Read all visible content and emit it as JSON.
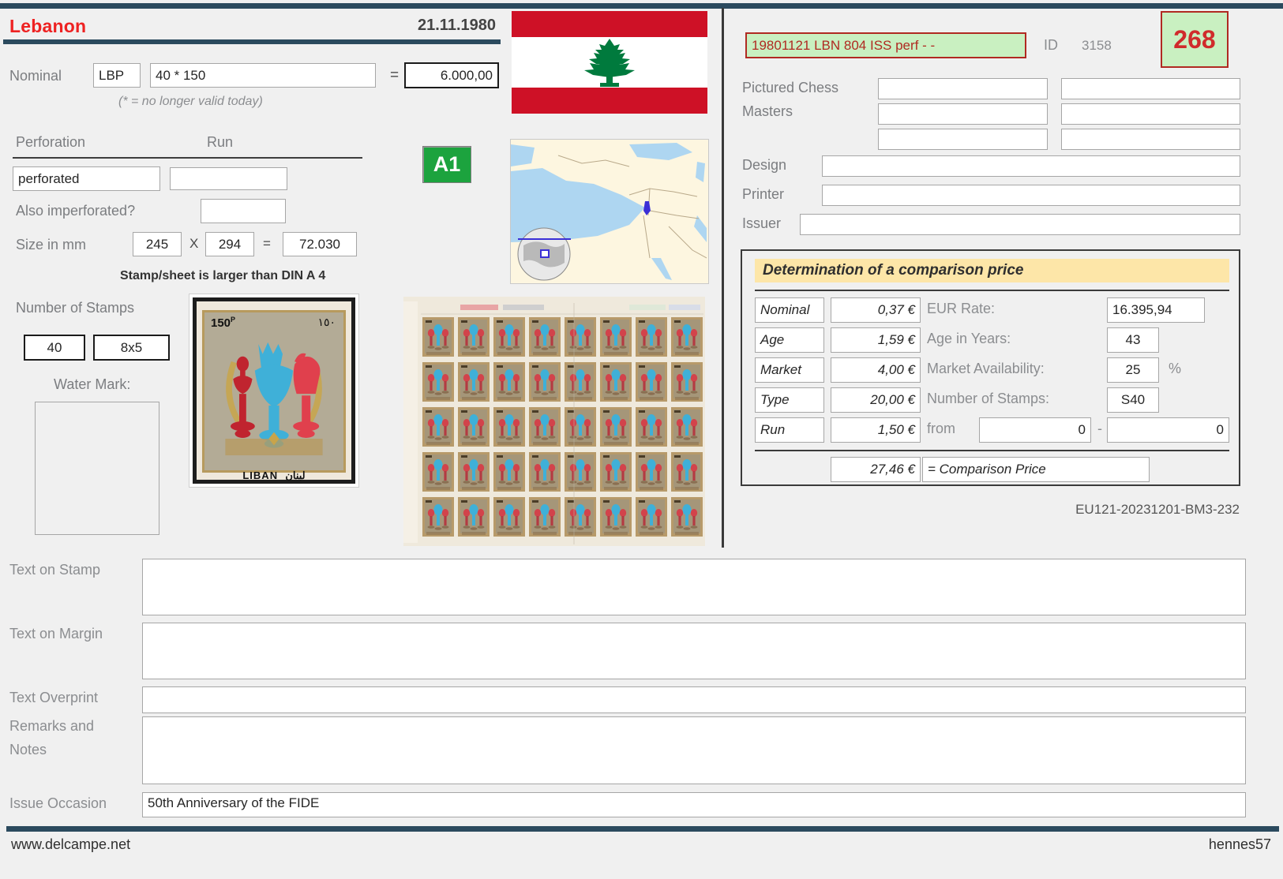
{
  "header": {
    "country": "Lebanon",
    "issue_date": "21.11.1980"
  },
  "nominal": {
    "label": "Nominal",
    "currency": "LBP",
    "expression": "40 * 150",
    "equals": "=",
    "total": "6.000,00",
    "note": "(* = no longer valid today)"
  },
  "perforation": {
    "label": "Perforation",
    "run_label": "Run",
    "value": "perforated",
    "run_value": "",
    "also_imperforated_label": "Also imperforated?",
    "also_imperforated_value": ""
  },
  "size": {
    "label": "Size in mm",
    "width": "245",
    "x": "X",
    "height": "294",
    "equals": "=",
    "area": "72.030",
    "note": "Stamp/sheet is larger than DIN A 4"
  },
  "stamps": {
    "label": "Number of Stamps",
    "count": "40",
    "grid": "8x5",
    "watermark_label": "Water Mark:",
    "watermark_value": ""
  },
  "badges": {
    "a1": "A1"
  },
  "right": {
    "code": "19801121 LBN 804 ISS perf - -",
    "id_label": "ID",
    "id_value": "3158",
    "number": "268",
    "pictured_label_line1": "Pictured Chess",
    "pictured_label_line2": "Masters",
    "pictured_values": [
      "",
      "",
      "",
      "",
      "",
      ""
    ],
    "design_label": "Design",
    "design_value": "",
    "printer_label": "Printer",
    "printer_value": "",
    "issuer_label": "Issuer",
    "issuer_value": ""
  },
  "comparison": {
    "title": "Determination of a comparison price",
    "rows": [
      {
        "name": "Nominal",
        "amount": "0,37 €",
        "right_label": "EUR Rate:",
        "right_value": "16.395,94",
        "suffix": ""
      },
      {
        "name": "Age",
        "amount": "1,59 €",
        "right_label": "Age in Years:",
        "right_value": "43",
        "suffix": ""
      },
      {
        "name": "Market",
        "amount": "4,00 €",
        "right_label": "Market Availability:",
        "right_value": "25",
        "suffix": "%"
      },
      {
        "name": "Type",
        "amount": "20,00 €",
        "right_label": "Number of Stamps:",
        "right_value": "S40",
        "suffix": ""
      },
      {
        "name": "Run",
        "amount": "1,50 €",
        "right_label": "from",
        "right_value": "0",
        "suffix": "-"
      }
    ],
    "range_to": "0",
    "result_amount": "27,46 €",
    "result_label": "= Comparison Price",
    "footer_code": "EU121-20231201-BM3-232"
  },
  "bottom": {
    "text_on_stamp_label": "Text on Stamp",
    "text_on_stamp_value": "",
    "text_on_margin_label": "Text on Margin",
    "text_on_margin_value": "",
    "text_overprint_label": "Text Overprint",
    "text_overprint_value": "",
    "remarks_label_line1": "Remarks and",
    "remarks_label_line2": "Notes",
    "remarks_value": "",
    "issue_occasion_label": "Issue Occasion",
    "issue_occasion_value": "50th Anniversary of the FIDE"
  },
  "stamp_art": {
    "denomination": "150",
    "denomination_unit": "P",
    "arabic_value": "١٥٠",
    "country_latin": "LIBAN",
    "country_arabic": "لبنان"
  },
  "footer": {
    "left": "www.delcampe.net",
    "right": "hennes57"
  },
  "colors": {
    "accent_rule": "#2b4a5e",
    "country_red": "#ee2222",
    "badge_green": "#1ca33e",
    "code_green_bg": "#c9f0c1",
    "code_red_border": "#b02a22",
    "title_yellow": "#fde6a8",
    "flag_red": "#ce1126",
    "cedar_green": "#007a3d"
  }
}
